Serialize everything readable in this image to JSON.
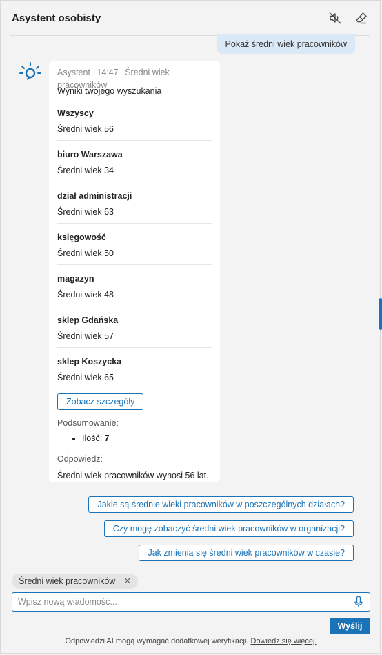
{
  "header": {
    "title": "Asystent osobisty",
    "mute_icon": "speaker-muted-icon",
    "clear_icon": "eraser-icon"
  },
  "user_message": "Pokaż średni wiek pracowników",
  "bot": {
    "sender": "Asystent",
    "time": "14:47",
    "topic": "Średni wiek pracowników",
    "results_caption": "Wyniki twojego wyszukania",
    "results": [
      {
        "name": "Wszyscy",
        "age_label": "Średni wiek 56"
      },
      {
        "name": "biuro Warszawa",
        "age_label": "Średni wiek 34"
      },
      {
        "name": "dział administracji",
        "age_label": "Średni wiek 63"
      },
      {
        "name": "księgowość",
        "age_label": "Średni wiek 50"
      },
      {
        "name": "magazyn",
        "age_label": "Średni wiek 48"
      },
      {
        "name": "sklep Gdańska",
        "age_label": "Średni wiek 57"
      },
      {
        "name": "sklep Koszycka",
        "age_label": "Średni wiek 65"
      }
    ],
    "details_button": "Zobacz szczegóły",
    "summary_label": "Podsumowanie:",
    "summary_item_label": "Ilość:",
    "summary_item_value": "7",
    "answer_label": "Odpowiedź:",
    "answer_text": "Średni wiek pracowników wynosi 56 lat."
  },
  "suggestions": [
    "Jakie są średnie wieki pracowników w poszczególnych działach?",
    "Czy mogę zobaczyć średni wiek pracowników w organizacji?",
    "Jak zmienia się średni wiek pracowników w czasie?"
  ],
  "context_chip": "Średni wiek pracowników",
  "input": {
    "placeholder": "Wpisz nową wiadomość...",
    "value": ""
  },
  "send_button": "Wyślij",
  "disclaimer": {
    "text": "Odpowiedzi AI mogą wymagać dodatkowej weryfikacji.",
    "link": "Dowiedz się więcej."
  },
  "colors": {
    "accent": "#1a73b7",
    "user_bubble": "#dbe9f6",
    "background": "#f3f3f3"
  }
}
